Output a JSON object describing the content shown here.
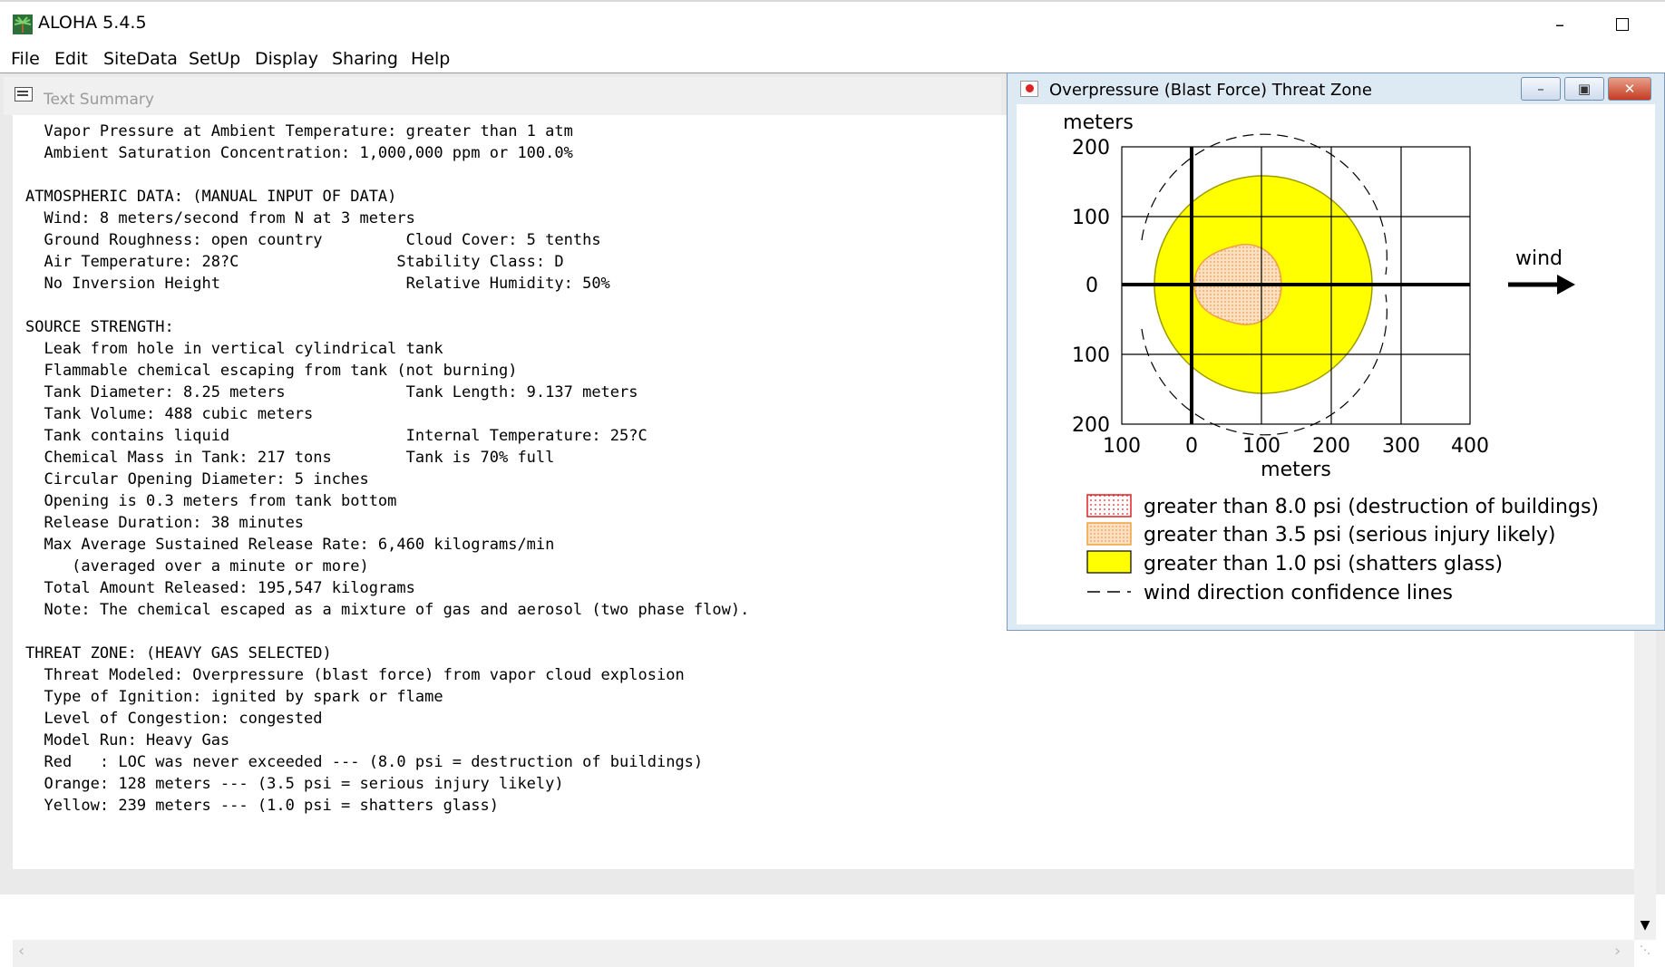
{
  "app": {
    "title": "ALOHA 5.4.5",
    "icon": "palm-tree-icon",
    "controls": {
      "minimize": "–"
    }
  },
  "menu": [
    "File",
    "Edit",
    "SiteData",
    "SetUp",
    "Display",
    "Sharing",
    "Help"
  ],
  "text_summary": {
    "title": "Text Summary",
    "lines": [
      "  Vapor Pressure at Ambient Temperature: greater than 1 atm",
      "  Ambient Saturation Concentration: 1,000,000 ppm or 100.0%",
      "",
      "ATMOSPHERIC DATA: (MANUAL INPUT OF DATA)",
      "  Wind: 8 meters/second from N at 3 meters",
      "  Ground Roughness: open country         Cloud Cover: 5 tenths",
      "  Air Temperature: 28?C                 Stability Class: D",
      "  No Inversion Height                    Relative Humidity: 50%",
      "",
      "SOURCE STRENGTH:",
      "  Leak from hole in vertical cylindrical tank",
      "  Flammable chemical escaping from tank (not burning)",
      "  Tank Diameter: 8.25 meters             Tank Length: 9.137 meters",
      "  Tank Volume: 488 cubic meters",
      "  Tank contains liquid                   Internal Temperature: 25?C",
      "  Chemical Mass in Tank: 217 tons        Tank is 70% full",
      "  Circular Opening Diameter: 5 inches",
      "  Opening is 0.3 meters from tank bottom",
      "  Release Duration: 38 minutes",
      "  Max Average Sustained Release Rate: 6,460 kilograms/min",
      "     (averaged over a minute or more)",
      "  Total Amount Released: 195,547 kilograms",
      "  Note: The chemical escaped as a mixture of gas and aerosol (two phase flow).",
      "",
      "THREAT ZONE: (HEAVY GAS SELECTED)",
      "  Threat Modeled: Overpressure (blast force) from vapor cloud explosion",
      "  Type of Ignition: ignited by spark or flame",
      "  Level of Congestion: congested",
      "  Model Run: Heavy Gas",
      "  Red   : LOC was never exceeded --- (8.0 psi = destruction of buildings)",
      "  Orange: 128 meters --- (3.5 psi = serious injury likely)",
      "  Yellow: 239 meters --- (1.0 psi = shatters glass)"
    ]
  },
  "threat_window": {
    "title": "Overpressure (Blast Force) Threat Zone",
    "buttons": {
      "minimize": "–",
      "restore": "▣",
      "close": "✕"
    },
    "plot": {
      "ylabel": "meters",
      "xlabel": "meters",
      "y_ticks": [
        "200",
        "100",
        "0",
        "100",
        "200"
      ],
      "x_ticks": [
        "100",
        "0",
        "100",
        "200",
        "300",
        "400"
      ],
      "wind_label": "wind",
      "yellow_radius_m": 239,
      "orange_extent_m": 128
    },
    "legend": [
      {
        "label": "greater than 8.0 psi (destruction of buildings)",
        "color": "#ff0000",
        "style": "dotted"
      },
      {
        "label": "greater than 3.5 psi (serious injury likely)",
        "color": "#f4a460",
        "style": "stipple"
      },
      {
        "label": "greater than 1.0 psi (shatters glass)",
        "color": "#ffff00",
        "style": "solid"
      },
      {
        "label": "wind direction confidence lines",
        "color": "#000000",
        "style": "dashed"
      }
    ]
  }
}
